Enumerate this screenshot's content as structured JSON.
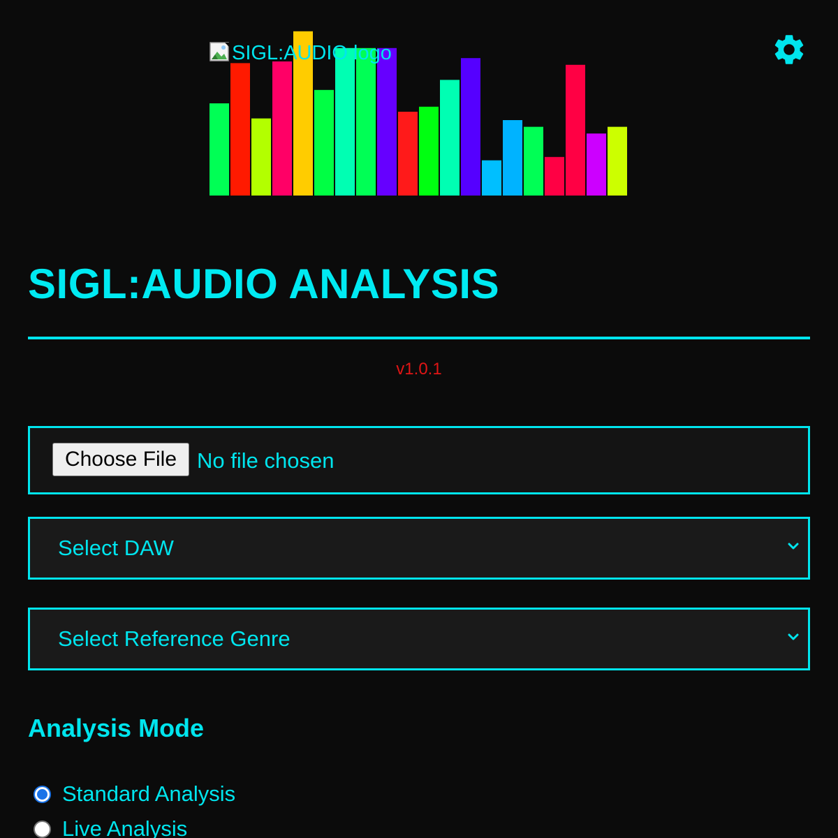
{
  "header": {
    "logo_alt": "SIGL:AUDIO logo",
    "settings_icon": "gear-icon"
  },
  "visualizer_bars": [
    {
      "level": 0.55,
      "color": "#00ff55"
    },
    {
      "level": 0.79,
      "color": "#ff1a00"
    },
    {
      "level": 0.46,
      "color": "#b3ff00"
    },
    {
      "level": 0.8,
      "color": "#ff0066"
    },
    {
      "level": 0.98,
      "color": "#ffcc00"
    },
    {
      "level": 0.63,
      "color": "#00ff44"
    },
    {
      "level": 0.88,
      "color": "#00ffb3"
    },
    {
      "level": 0.88,
      "color": "#00ff55"
    },
    {
      "level": 0.88,
      "color": "#6600ff"
    },
    {
      "level": 0.5,
      "color": "#ff1a1a"
    },
    {
      "level": 0.53,
      "color": "#00ff11"
    },
    {
      "level": 0.69,
      "color": "#00ffb3"
    },
    {
      "level": 0.82,
      "color": "#5500ff"
    },
    {
      "level": 0.21,
      "color": "#00bfff"
    },
    {
      "level": 0.45,
      "color": "#00b3ff"
    },
    {
      "level": 0.41,
      "color": "#00ff55"
    },
    {
      "level": 0.23,
      "color": "#ff0044"
    },
    {
      "level": 0.78,
      "color": "#ff0044"
    },
    {
      "level": 0.37,
      "color": "#cc00ff"
    },
    {
      "level": 0.41,
      "color": "#ccff00"
    }
  ],
  "page": {
    "title": "SIGL:AUDIO ANALYSIS",
    "version": "v1.0.1"
  },
  "file_input": {
    "button_label": "Choose File",
    "status": "No file chosen"
  },
  "daw_select": {
    "selected": "Select DAW"
  },
  "genre_select": {
    "selected": "Select Reference Genre"
  },
  "analysis_mode": {
    "heading": "Analysis Mode",
    "options": [
      {
        "label": "Standard Analysis",
        "checked": true
      },
      {
        "label": "Live Analysis",
        "checked": false
      }
    ]
  },
  "colors": {
    "accent": "#00e5ee",
    "version": "#e01515",
    "background": "#0b0b0b"
  }
}
